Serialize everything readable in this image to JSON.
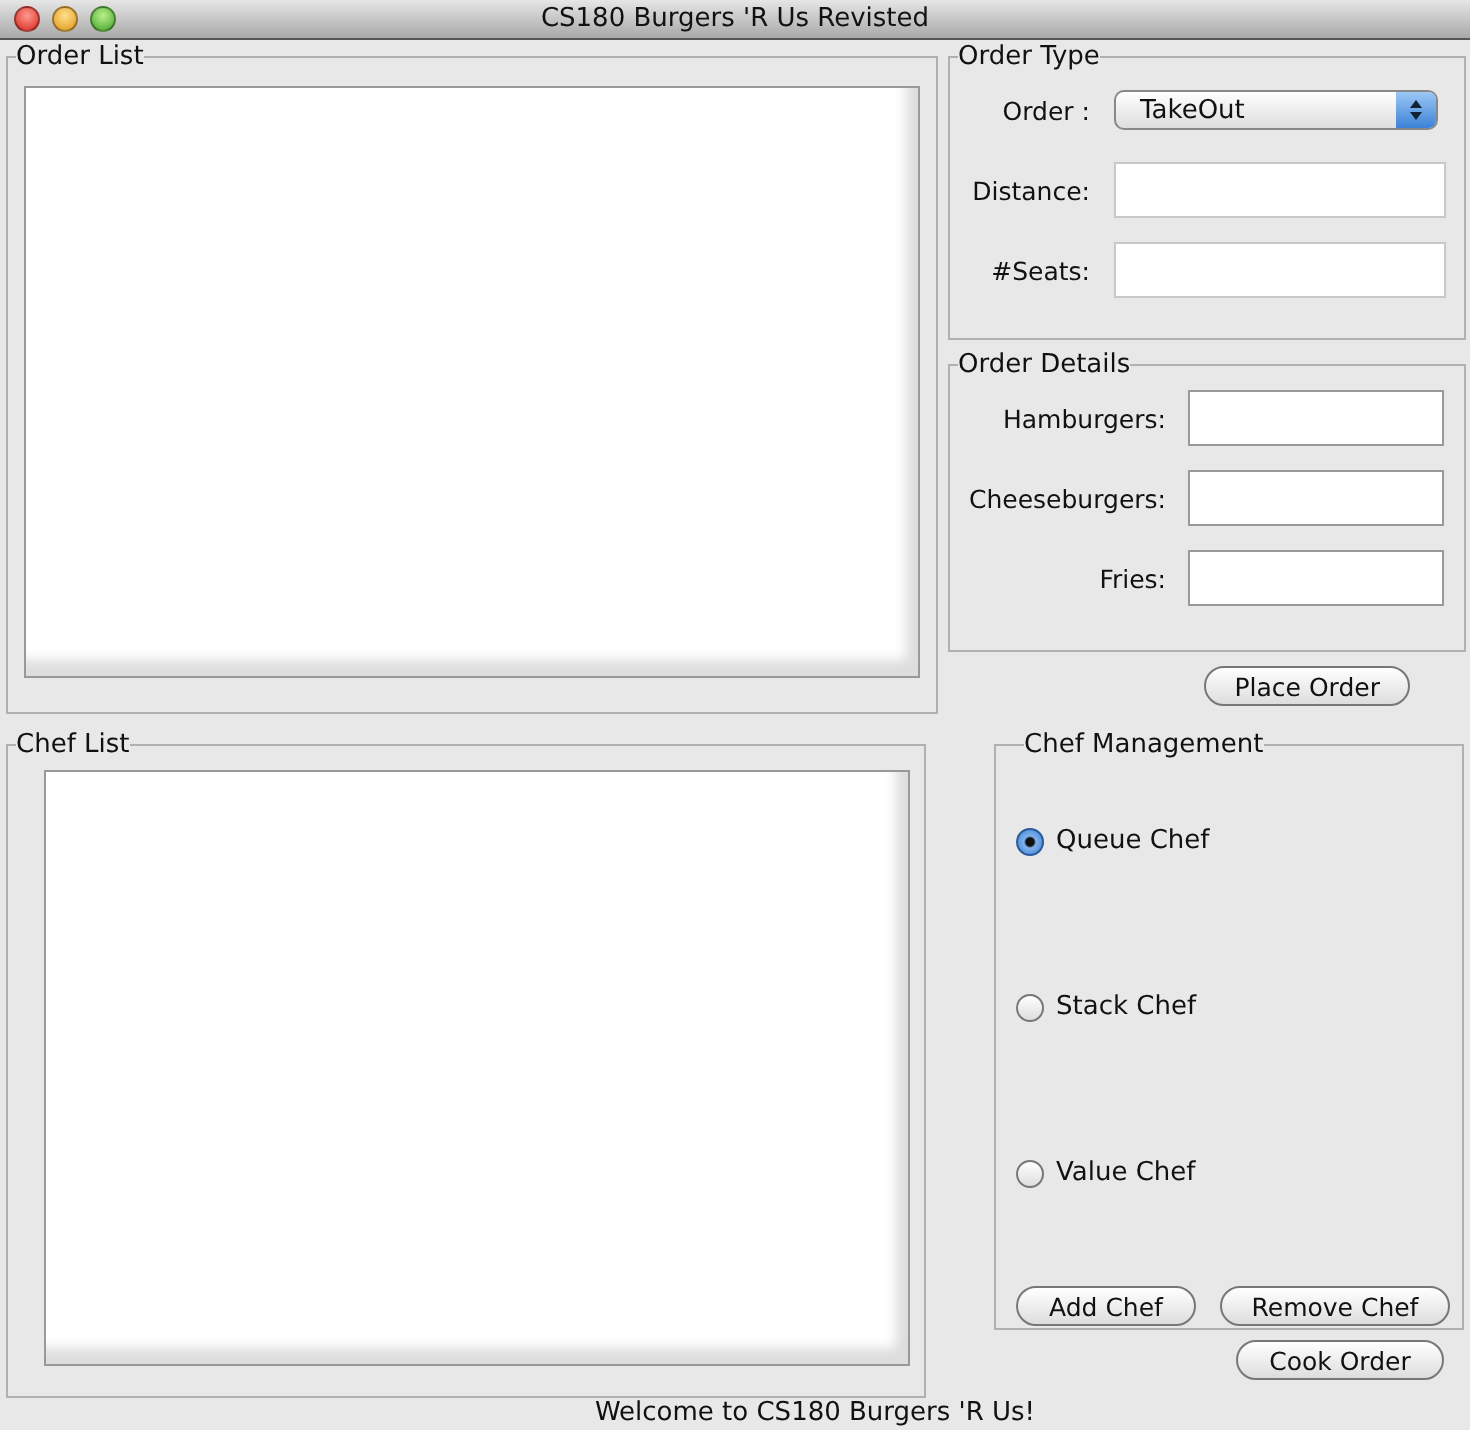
{
  "window": {
    "title": "CS180 Burgers 'R Us Revisted"
  },
  "order_list": {
    "title": "Order List"
  },
  "order_type": {
    "title": "Order Type",
    "fields": [
      {
        "kind": "select",
        "label": "Order :",
        "value": "TakeOut"
      },
      {
        "kind": "text",
        "label": "Distance:"
      },
      {
        "kind": "text",
        "label": "#Seats:"
      }
    ]
  },
  "order_details": {
    "title": "Order Details",
    "fields": [
      {
        "kind": "text",
        "label": "Hamburgers:"
      },
      {
        "kind": "text",
        "label": "Cheeseburgers:"
      },
      {
        "kind": "text",
        "label": "Fries:"
      }
    ]
  },
  "place_order_button": "Place Order",
  "chef_list": {
    "title": "Chef List"
  },
  "chef_management": {
    "title": "Chef Management",
    "options": [
      {
        "label": "Queue Chef",
        "selected": true
      },
      {
        "label": "Stack Chef",
        "selected": false
      },
      {
        "label": "Value Chef",
        "selected": false
      }
    ],
    "buttons": [
      "Add Chef",
      "Remove Chef"
    ]
  },
  "cook_order_button": "Cook Order",
  "status_bar": "Welcome to CS180 Burgers 'R Us!"
}
